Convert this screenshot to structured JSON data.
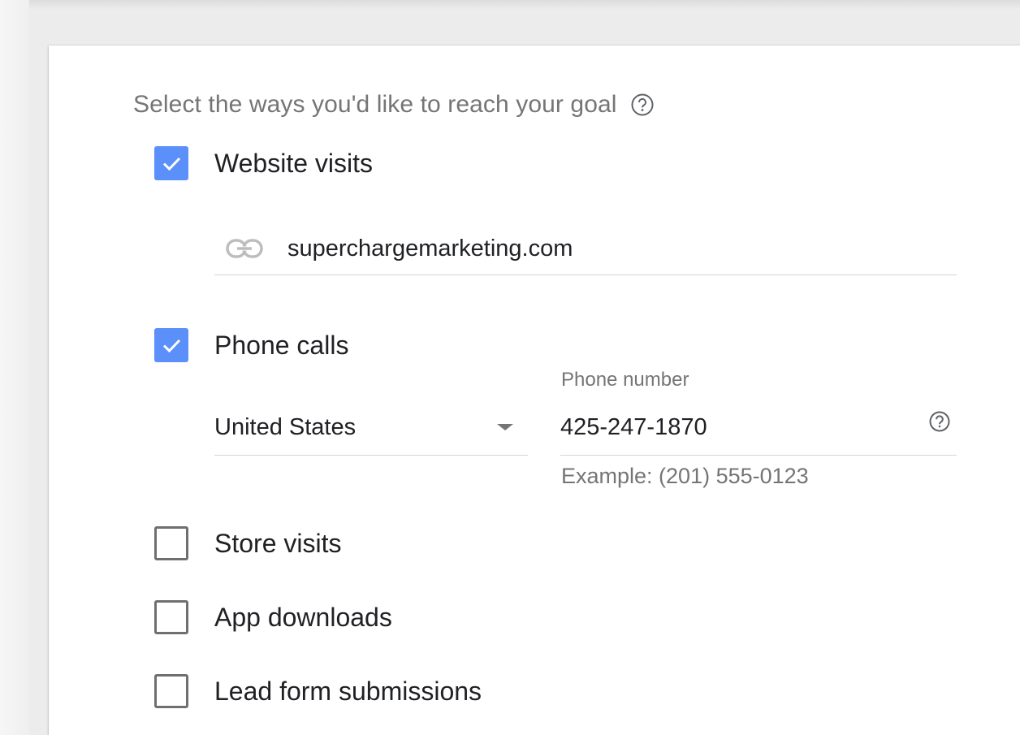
{
  "header": {
    "title": "Select the ways you'd like to reach your goal"
  },
  "options": {
    "website_visits": {
      "label": "Website visits",
      "checked": true
    },
    "phone_calls": {
      "label": "Phone calls",
      "checked": true
    },
    "store_visits": {
      "label": "Store visits",
      "checked": false
    },
    "app_downloads": {
      "label": "App downloads",
      "checked": false
    },
    "lead_form_submissions": {
      "label": "Lead form submissions",
      "checked": false
    }
  },
  "website": {
    "url": "superchargemarketing.com",
    "icon": "link-icon"
  },
  "phone": {
    "country": "United States",
    "label": "Phone number",
    "value": "425-247-1870",
    "example": "Example: (201) 555-0123"
  },
  "colors": {
    "checkbox_checked": "#5b8ff9",
    "secondary_text": "#757575",
    "primary_text": "#202124"
  }
}
